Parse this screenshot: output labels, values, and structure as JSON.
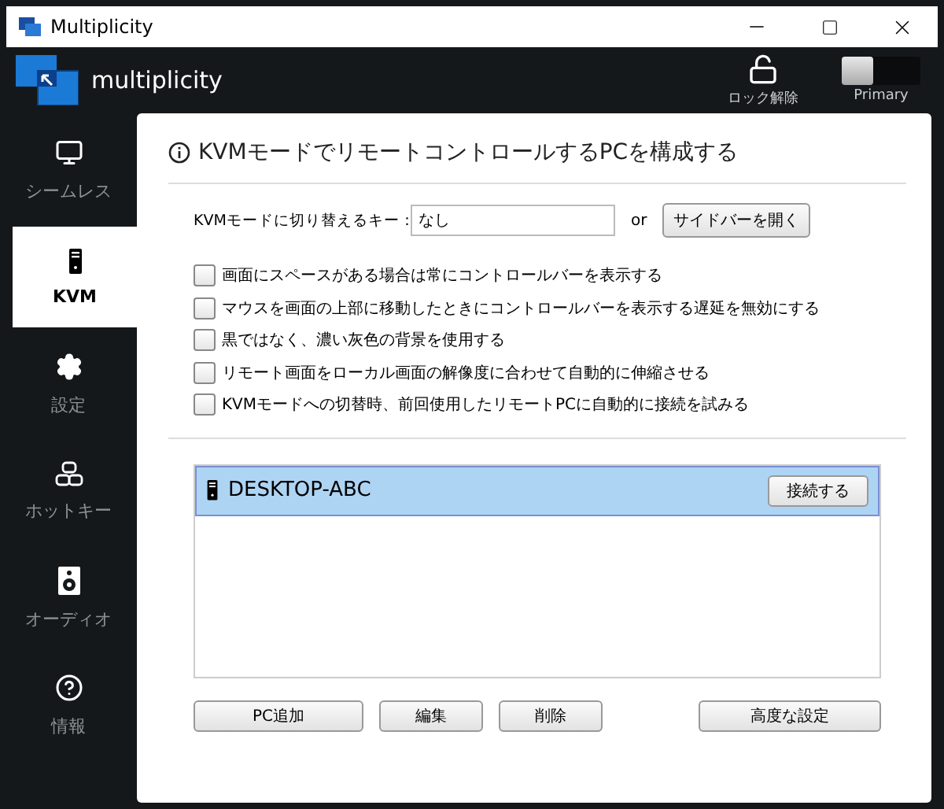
{
  "window": {
    "title": "Multiplicity"
  },
  "header": {
    "brand": "multiplicity",
    "lock_label": "ロック解除",
    "mode_switch": {
      "label": "Primary",
      "on": false
    }
  },
  "sidebar": {
    "items": [
      {
        "label": "シームレス",
        "selected": false
      },
      {
        "label": "KVM",
        "selected": true
      },
      {
        "label": "設定",
        "selected": false
      },
      {
        "label": "ホットキー",
        "selected": false
      },
      {
        "label": "オーディオ",
        "selected": false
      },
      {
        "label": "情報",
        "selected": false
      }
    ]
  },
  "content": {
    "title": "KVMモードでリモートコントロールするPCを構成する",
    "hotkey": {
      "label": "KVMモードに切り替えるキー：",
      "value": "なし",
      "or": "or",
      "button": "サイドバーを開く"
    },
    "options": [
      {
        "label": "画面にスペースがある場合は常にコントロールバーを表示する",
        "checked": false
      },
      {
        "label": "マウスを画面の上部に移動したときにコントロールバーを表示する遅延を無効にする",
        "checked": false
      },
      {
        "label": "黒ではなく、濃い灰色の背景を使用する",
        "checked": false
      },
      {
        "label": "リモート画面をローカル画面の解像度に合わせて自動的に伸縮させる",
        "checked": false
      },
      {
        "label": "KVMモードへの切替時、前回使用したリモートPCに自動的に接続を試みる",
        "checked": false
      }
    ],
    "pcs": [
      {
        "name": "DESKTOP-ABC",
        "selected": true,
        "action": "接続する"
      }
    ],
    "buttons": [
      "PC追加",
      "編集",
      "削除",
      "高度な設定"
    ]
  }
}
